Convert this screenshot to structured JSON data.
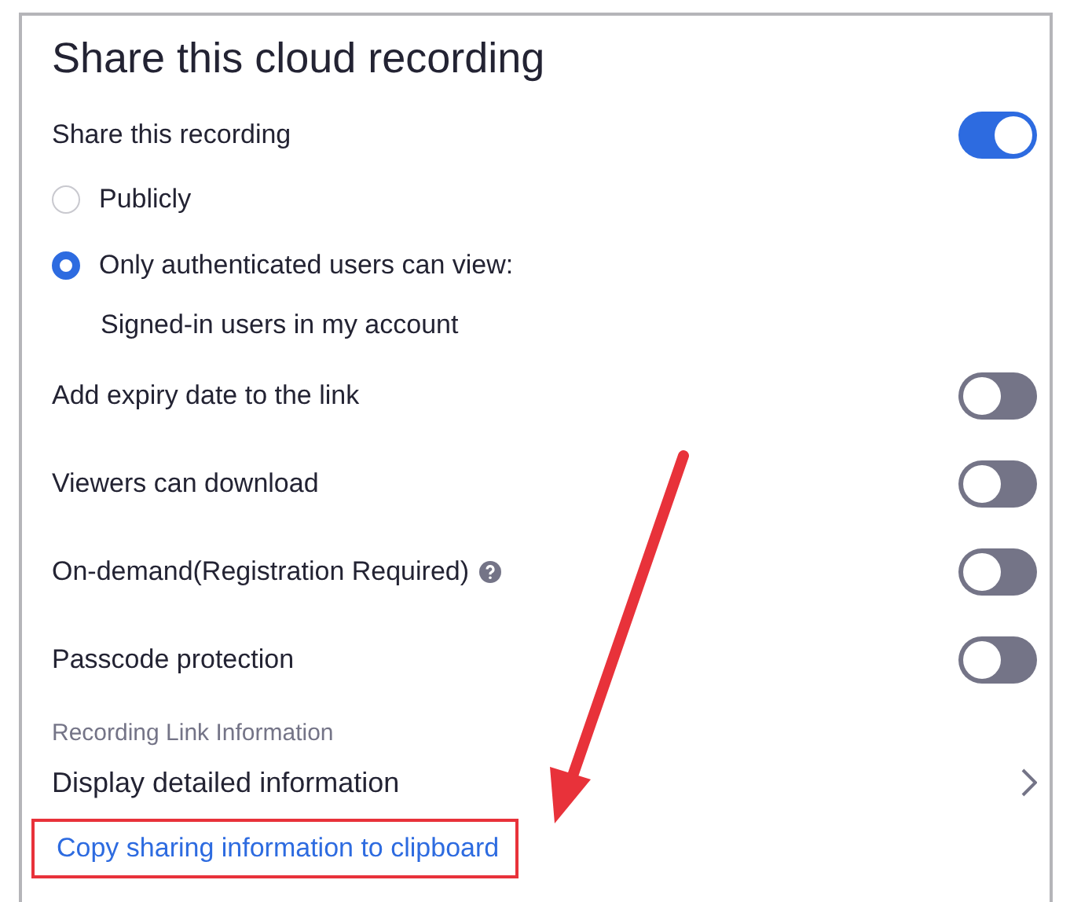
{
  "title": "Share this cloud recording",
  "rows": [
    {
      "kind": "toggle",
      "label": "Share this recording",
      "on": true
    },
    {
      "kind": "radio",
      "label": "Publicly",
      "selected": false
    },
    {
      "kind": "radio",
      "label": "Only authenticated users can view:",
      "selected": true
    },
    {
      "kind": "note",
      "label": "Signed-in users in my account"
    },
    {
      "kind": "toggle",
      "label": "Add expiry date to the link",
      "on": false
    },
    {
      "kind": "toggle",
      "label": "Viewers can download",
      "on": false
    },
    {
      "kind": "toggle",
      "label": "On-demand(Registration Required)",
      "on": false,
      "help": true
    },
    {
      "kind": "toggle",
      "label": "Passcode protection",
      "on": false
    },
    {
      "kind": "section",
      "label": "Recording Link Information"
    },
    {
      "kind": "nav",
      "label": "Display detailed information"
    },
    {
      "kind": "link",
      "label": "Copy sharing information to clipboard",
      "highlighted": true
    }
  ],
  "annotation": {
    "arrow": true
  }
}
